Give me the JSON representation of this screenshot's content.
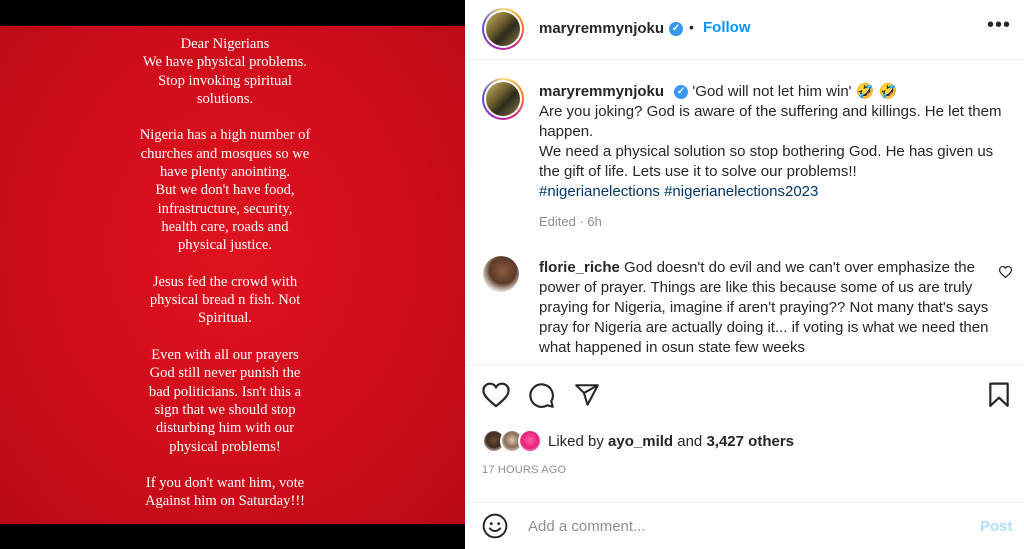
{
  "media": {
    "paragraphs": [
      "Dear Nigerians\nWe have physical problems.\nStop invoking spiritual\nsolutions.",
      "Nigeria has a high number of\nchurches and mosques so we\nhave plenty anointing.\nBut we don't have food,\ninfrastructure, security,\nhealth care, roads and\nphysical justice.",
      "Jesus fed the crowd with\nphysical bread n fish. Not\nSpiritual.",
      "Even with all our prayers\nGod still never punish the\nbad politicians. Isn't this a\nsign that we should stop\ndisturbing him with our\nphysical problems!",
      "If you don't want him, vote\nAgainst him on Saturday!!!"
    ]
  },
  "header": {
    "username": "maryremmynjoku",
    "verified_icon": "✓",
    "separator": "•",
    "follow_label": "Follow",
    "more_icon": "•••"
  },
  "caption": {
    "username": "maryremmynjoku",
    "verified_icon": "✓",
    "text": "'God will not let him win' 🤣 🤣\nAre you joking? God is aware of the suffering and killings. He let them happen.\nWe need a physical solution so stop bothering God. He has given us the gift of life. Lets use it to solve our problems!!",
    "hashtags": "#nigerianelections #nigerianelections2023",
    "meta": "Edited · 6h"
  },
  "comment": {
    "username": "florie_riche",
    "text": "God doesn't do evil and we can't over emphasize the power of prayer. Things are like this because some of us are truly praying for Nigeria, imagine if aren't praying?? Not many that's says pray for Nigeria are actually doing it... if voting is what we need then what happened in osun state few weeks"
  },
  "likes": {
    "prefix": "Liked by",
    "user": "ayo_mild",
    "conj": "and",
    "others": "3,427 others"
  },
  "time_ago": "17 HOURS AGO",
  "add_comment": {
    "placeholder": "Add a comment...",
    "post_label": "Post"
  },
  "colors": {
    "accent": "#0095f6",
    "background_red": "#d4101d",
    "hashtag": "#00376b",
    "muted": "#8e8e8e"
  }
}
